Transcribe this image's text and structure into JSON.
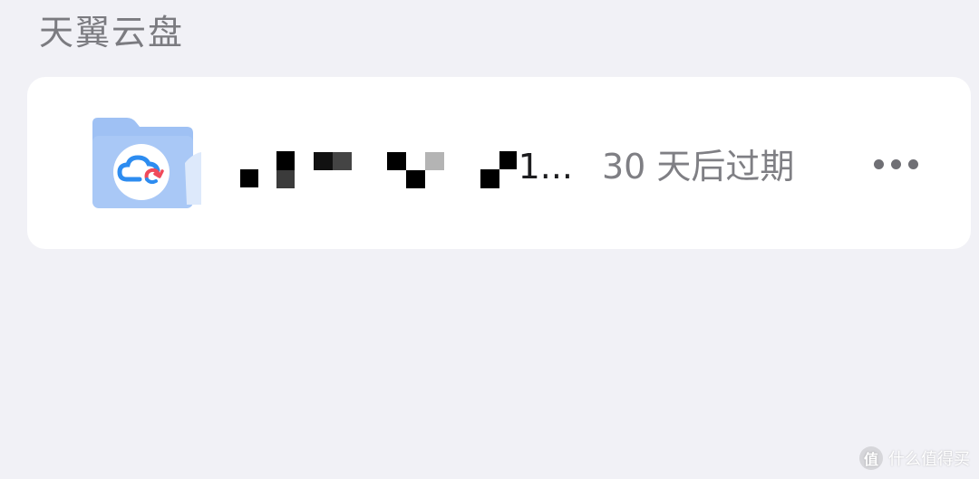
{
  "section": {
    "title": "天翼云盘"
  },
  "file": {
    "name_visible": "1...",
    "name_redacted": true,
    "expiry": "30 天后过期",
    "icon": "cloud-folder-icon"
  },
  "actions": {
    "more_icon": "more-horizontal-icon"
  },
  "watermark": {
    "text": "什么值得买",
    "icon": "zhi-badge-icon",
    "badge_char": "值"
  },
  "colors": {
    "background": "#f1f1f6",
    "card": "#ffffff",
    "folder_blue": "#a9c8f6",
    "cloud_blue": "#2d8cf0",
    "cloud_red": "#f04a5a",
    "muted_text": "#7f7f84"
  }
}
